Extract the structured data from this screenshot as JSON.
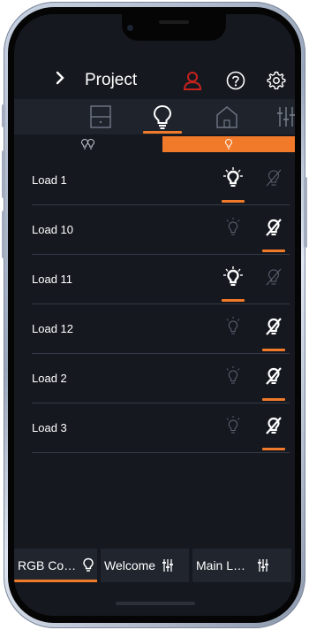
{
  "header": {
    "back_icon": "chevron-right-icon",
    "title": "Project",
    "icons": [
      "user-icon",
      "help-icon",
      "settings-gear-icon"
    ],
    "user_icon_color": "#c7221d"
  },
  "tabs": [
    {
      "icon": "cabinet-icon",
      "active": false
    },
    {
      "icon": "lightbulb-icon",
      "active": true
    },
    {
      "icon": "house-icon",
      "active": false
    },
    {
      "icon": "sliders-icon",
      "active": false
    }
  ],
  "segments": [
    {
      "icon": "multi-bulb-icon",
      "active": false
    },
    {
      "icon": "bulb-small-icon",
      "active": true
    }
  ],
  "loads": [
    {
      "label": "Load 1",
      "state": "on"
    },
    {
      "label": "Load 10",
      "state": "off"
    },
    {
      "label": "Load 11",
      "state": "on"
    },
    {
      "label": "Load 12",
      "state": "off"
    },
    {
      "label": "Load 2",
      "state": "off"
    },
    {
      "label": "Load 3",
      "state": "off"
    }
  ],
  "scenes": [
    {
      "label": "RGB Co…",
      "icon": "lightbulb-icon",
      "active": true
    },
    {
      "label": "Welcome",
      "icon": "sliders-icon",
      "active": false
    },
    {
      "label": "Main L…",
      "icon": "sliders-icon",
      "active": false
    }
  ],
  "colors": {
    "accent": "#f07a2a",
    "background": "#15181f",
    "tab_bar": "#1e232c",
    "text": "#ffffff"
  }
}
